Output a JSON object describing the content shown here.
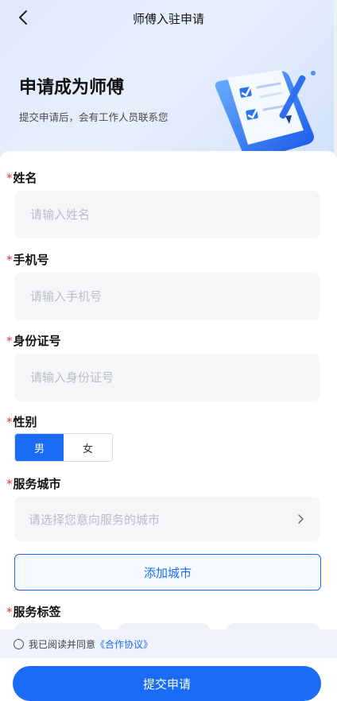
{
  "header": {
    "title": "师傅入驻申请"
  },
  "hero": {
    "title": "申请成为师傅",
    "subtitle": "提交申请后，会有工作人员联系您"
  },
  "form": {
    "required_mark": "*",
    "name": {
      "label": "姓名",
      "placeholder": "请输入姓名"
    },
    "phone": {
      "label": "手机号",
      "placeholder": "请输入手机号"
    },
    "id_number": {
      "label": "身份证号",
      "placeholder": "请输入身份证号"
    },
    "gender": {
      "label": "性别",
      "options": [
        "男",
        "女"
      ],
      "selected": "男"
    },
    "service_city": {
      "label": "服务城市",
      "placeholder": "请选择您意向服务的城市"
    },
    "add_city_label": "添加城市",
    "service_tags": {
      "label": "服务标签"
    }
  },
  "agreement": {
    "prefix": "我已阅读并同意",
    "link": "《合作协议》",
    "checked": false
  },
  "submit_label": "提交申请",
  "colors": {
    "accent": "#1a6bf5",
    "required": "#e53935",
    "field_bg": "#f5f6f8"
  },
  "icons": {
    "back": "chevron-left-icon",
    "city_arrow": "chevron-right-icon",
    "hero": "checklist-scroll-pen-illustration"
  }
}
